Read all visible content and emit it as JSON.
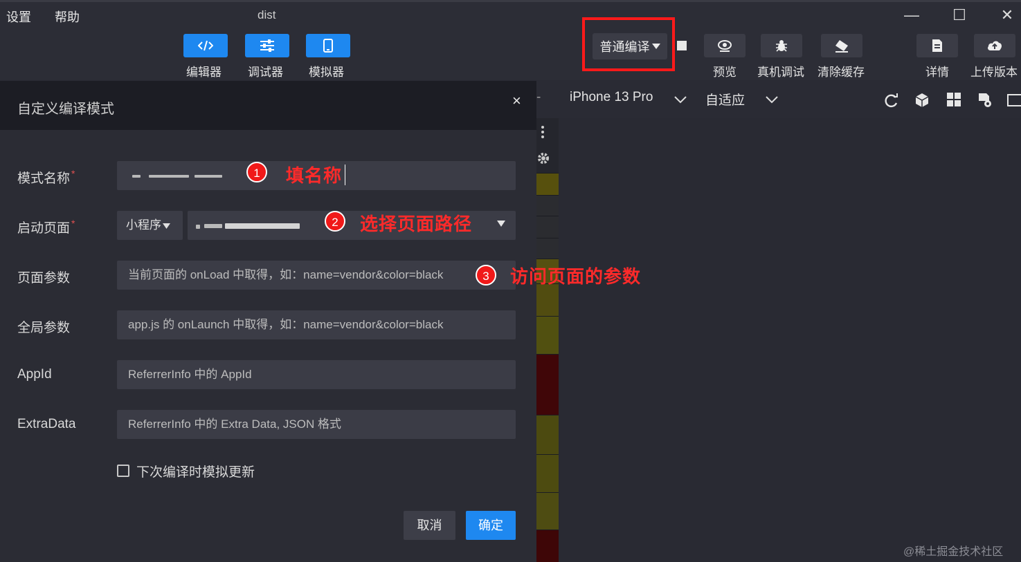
{
  "menu": {
    "settings": "设置",
    "help": "帮助"
  },
  "window": {
    "title": "dist",
    "minimize": "—",
    "maximize": "☐",
    "close": "✕"
  },
  "toolbar": {
    "editor": "编辑器",
    "debugger": "调试器",
    "simulator": "模拟器",
    "compile_mode": "普通编译",
    "preview": "预览",
    "remote_debug": "真机调试",
    "clear_cache": "清除缓存",
    "details": "详情",
    "upload": "上传版本"
  },
  "simulator_bar": {
    "device": "iPhone 13 Pro",
    "zoom": "自适应"
  },
  "dialog": {
    "title": "自定义编译模式",
    "close": "×",
    "fields": {
      "mode_name": {
        "label": "模式名称",
        "required": "*"
      },
      "launch_page": {
        "label": "启动页面",
        "required": "*",
        "type_value": "小程序"
      },
      "page_params": {
        "label": "页面参数",
        "placeholder": "当前页面的 onLoad 中取得，如：name=vendor&color=black"
      },
      "global_params": {
        "label": "全局参数",
        "placeholder": "app.js 的 onLaunch 中取得，如：name=vendor&color=black"
      },
      "appid": {
        "label": "AppId",
        "placeholder": "ReferrerInfo 中的 AppId"
      },
      "extra_data": {
        "label": "ExtraData",
        "placeholder": "ReferrerInfo 中的 Extra Data, JSON 格式"
      }
    },
    "checkbox_label": "下次编译时模拟更新",
    "cancel": "取消",
    "confirm": "确定"
  },
  "annotations": [
    {
      "number": "1",
      "text": "填名称"
    },
    {
      "number": "2",
      "text": "选择页面路径"
    },
    {
      "number": "3",
      "text": "访问页面的参数"
    }
  ],
  "watermark": "@稀土掘金技术社区",
  "colors": {
    "accent": "#1e88f0",
    "annotation": "#ff2a2a",
    "highlight": "#ff1a1a"
  }
}
